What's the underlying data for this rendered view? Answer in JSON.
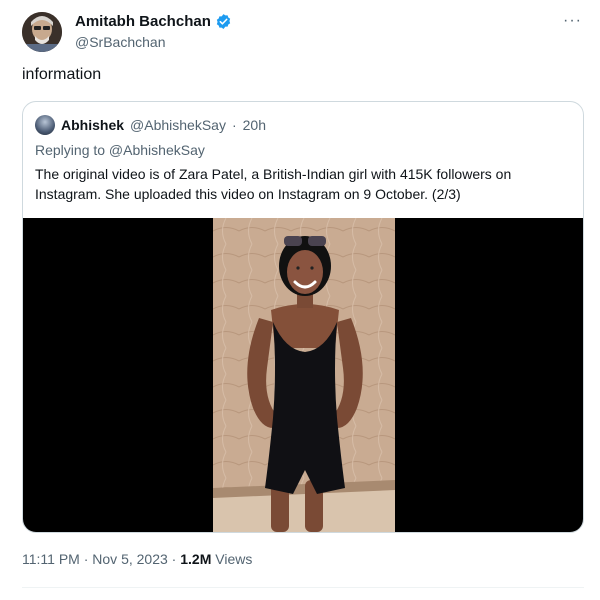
{
  "author": {
    "name": "Amitabh Bachchan",
    "handle": "@SrBachchan",
    "verified_icon": "verified-badge-icon",
    "avatar_icon": "avatar-photo"
  },
  "more_icon": "more-options-icon",
  "more_glyph": "···",
  "tweet_text": "information",
  "quoted": {
    "name": "Abhishek",
    "handle": "@AbhishekSay",
    "separator": "·",
    "time": "20h",
    "replying_to": "Replying to @AbhishekSay",
    "text": "The original video is of Zara Patel, a British-Indian girl with 415K followers on Instagram. She uploaded this video on Instagram on 9 October. (2/3)"
  },
  "meta": {
    "time": "11:11 PM · Nov 5, 2023 · ",
    "views_count": "1.2M",
    "views_label": " Views"
  },
  "colors": {
    "verified_blue": "#1d9bf0",
    "secondary_text": "#536471",
    "border": "#cfd9de"
  }
}
